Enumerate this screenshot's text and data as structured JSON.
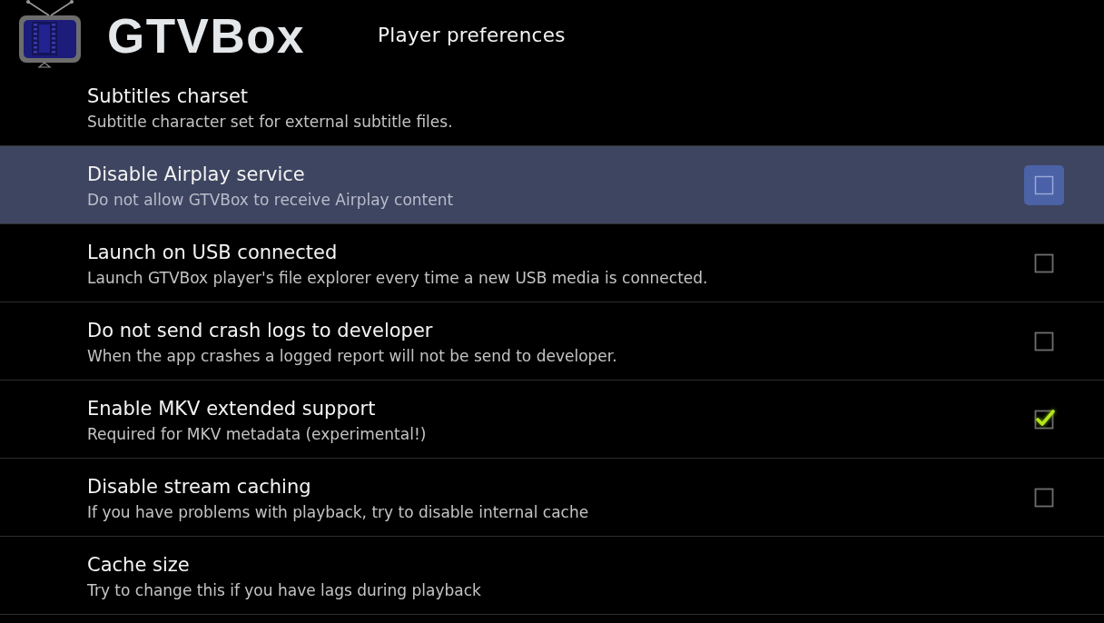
{
  "header": {
    "app_name": "GTVBox",
    "title": "Player preferences"
  },
  "preferences": [
    {
      "kind": "list",
      "title": "Subtitles charset",
      "summary": "Subtitle character set for external subtitle files.",
      "selected": false
    },
    {
      "kind": "checkbox",
      "title": "Disable Airplay service",
      "summary": "Do not allow GTVBox to receive Airplay content",
      "selected": true,
      "checked": false
    },
    {
      "kind": "checkbox",
      "title": "Launch on USB connected",
      "summary": "Launch GTVBox player's file explorer every time a new USB media is connected.",
      "selected": false,
      "checked": false
    },
    {
      "kind": "checkbox",
      "title": "Do not send crash logs to developer",
      "summary": "When the app crashes a logged report will not be send to developer.",
      "selected": false,
      "checked": false
    },
    {
      "kind": "checkbox",
      "title": "Enable MKV extended support",
      "summary": "Required for MKV metadata (experimental!)",
      "selected": false,
      "checked": true
    },
    {
      "kind": "checkbox",
      "title": "Disable stream caching",
      "summary": "If you have problems with playback, try to disable internal cache",
      "selected": false,
      "checked": false
    },
    {
      "kind": "list",
      "title": "Cache size",
      "summary": "Try to change this if you have lags during playback",
      "selected": false
    }
  ]
}
